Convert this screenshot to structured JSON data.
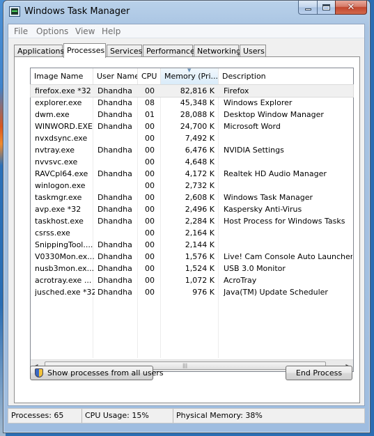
{
  "window": {
    "title": "Windows Task Manager"
  },
  "menu": [
    "File",
    "Options",
    "View",
    "Help"
  ],
  "tabs": [
    "Applications",
    "Processes",
    "Services",
    "Performance",
    "Networking",
    "Users"
  ],
  "active_tab": "Processes",
  "columns": {
    "image_name": "Image Name",
    "user_name": "User Name",
    "cpu": "CPU",
    "memory": "Memory (Pri...",
    "description": "Description"
  },
  "sorted_column": "memory",
  "processes": [
    {
      "name": "firefox.exe *32",
      "user": "Dhandha",
      "cpu": "00",
      "memory": "82,816 K",
      "description": "Firefox"
    },
    {
      "name": "explorer.exe",
      "user": "Dhandha",
      "cpu": "08",
      "memory": "45,348 K",
      "description": "Windows Explorer"
    },
    {
      "name": "dwm.exe",
      "user": "Dhandha",
      "cpu": "01",
      "memory": "28,088 K",
      "description": "Desktop Window Manager"
    },
    {
      "name": "WINWORD.EXE",
      "user": "Dhandha",
      "cpu": "00",
      "memory": "24,700 K",
      "description": "Microsoft Word"
    },
    {
      "name": "nvxdsync.exe",
      "user": "",
      "cpu": "00",
      "memory": "7,492 K",
      "description": ""
    },
    {
      "name": "nvtray.exe",
      "user": "Dhandha",
      "cpu": "00",
      "memory": "6,476 K",
      "description": "NVIDIA Settings"
    },
    {
      "name": "nvvsvc.exe",
      "user": "",
      "cpu": "00",
      "memory": "4,648 K",
      "description": ""
    },
    {
      "name": "RAVCpl64.exe",
      "user": "Dhandha",
      "cpu": "00",
      "memory": "4,172 K",
      "description": "Realtek HD Audio Manager"
    },
    {
      "name": "winlogon.exe",
      "user": "",
      "cpu": "00",
      "memory": "2,732 K",
      "description": ""
    },
    {
      "name": "taskmgr.exe",
      "user": "Dhandha",
      "cpu": "00",
      "memory": "2,608 K",
      "description": "Windows Task Manager"
    },
    {
      "name": "avp.exe *32",
      "user": "Dhandha",
      "cpu": "00",
      "memory": "2,496 K",
      "description": "Kaspersky Anti-Virus"
    },
    {
      "name": "taskhost.exe",
      "user": "Dhandha",
      "cpu": "00",
      "memory": "2,284 K",
      "description": "Host Process for Windows Tasks"
    },
    {
      "name": "csrss.exe",
      "user": "",
      "cpu": "00",
      "memory": "2,164 K",
      "description": ""
    },
    {
      "name": "SnippingTool....",
      "user": "Dhandha",
      "cpu": "00",
      "memory": "2,144 K",
      "description": ""
    },
    {
      "name": "V0330Mon.ex...",
      "user": "Dhandha",
      "cpu": "00",
      "memory": "1,576 K",
      "description": "Live! Cam Console Auto Launcher"
    },
    {
      "name": "nusb3mon.ex...",
      "user": "Dhandha",
      "cpu": "00",
      "memory": "1,524 K",
      "description": "USB 3.0 Monitor"
    },
    {
      "name": "acrotray.exe ...",
      "user": "Dhandha",
      "cpu": "00",
      "memory": "1,072 K",
      "description": "AcroTray"
    },
    {
      "name": "jusched.exe *32",
      "user": "Dhandha",
      "cpu": "00",
      "memory": "976 K",
      "description": "Java(TM) Update Scheduler"
    }
  ],
  "selected_row": 0,
  "buttons": {
    "show_all": "Show processes from all users",
    "end_process": "End Process"
  },
  "status": {
    "processes": "Processes: 65",
    "cpu_usage": "CPU Usage: 15%",
    "physical_memory": "Physical Memory: 38%"
  }
}
